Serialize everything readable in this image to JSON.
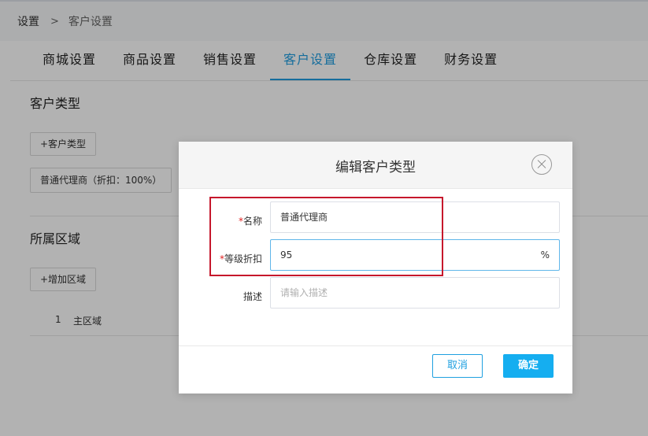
{
  "breadcrumb": {
    "root": "设置",
    "separator": ">",
    "current": "客户设置"
  },
  "tabs": [
    {
      "label": "商城设置",
      "active": false
    },
    {
      "label": "商品设置",
      "active": false
    },
    {
      "label": "销售设置",
      "active": false
    },
    {
      "label": "客户设置",
      "active": true
    },
    {
      "label": "仓库设置",
      "active": false
    },
    {
      "label": "财务设置",
      "active": false
    }
  ],
  "customer_type_section": {
    "title": "客户类型",
    "add_button": "+客户类型",
    "chips": [
      "普通代理商（折扣：100%）"
    ]
  },
  "region_section": {
    "title": "所属区域",
    "add_button": "+增加区域",
    "rows": [
      {
        "index": "1",
        "name": "主区域"
      }
    ]
  },
  "modal": {
    "title": "编辑客户类型",
    "fields": {
      "name": {
        "required_mark": "*",
        "label": "名称",
        "value": "普通代理商"
      },
      "discount": {
        "required_mark": "*",
        "label": "等级折扣",
        "value": "95",
        "suffix": "%"
      },
      "description": {
        "label": "描述",
        "placeholder": "请输入描述",
        "value": ""
      }
    },
    "cancel_label": "取消",
    "ok_label": "确定"
  },
  "colors": {
    "accent": "#1f9de0",
    "primary_button": "#15aef0",
    "highlight_border": "#c6182c",
    "required": "#e02020"
  }
}
